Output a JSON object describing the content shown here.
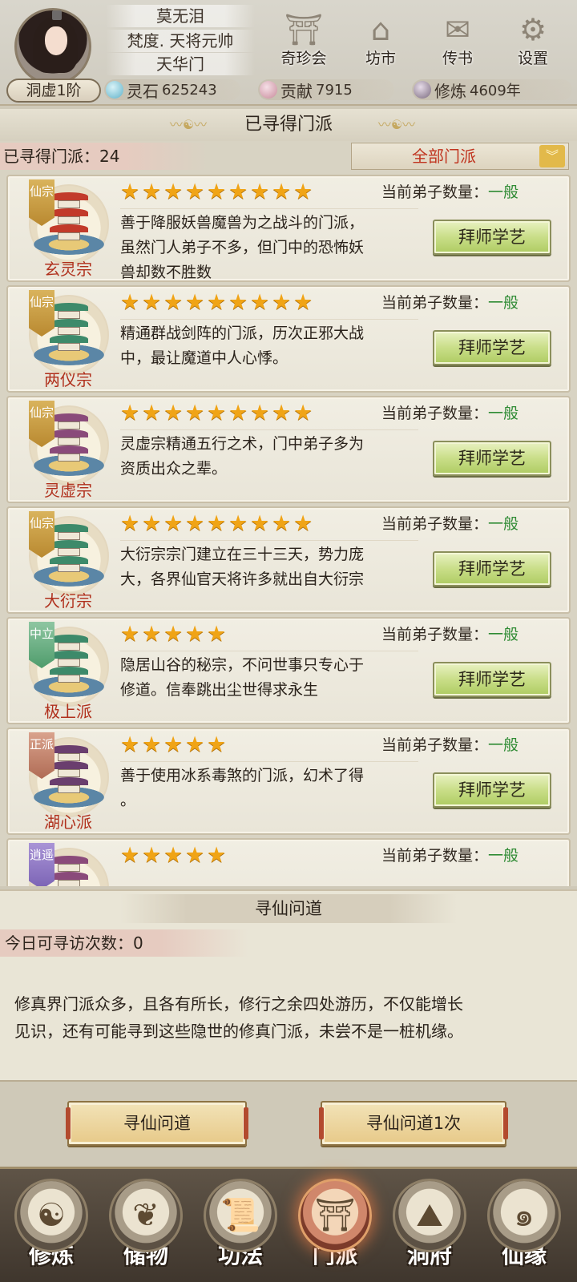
{
  "header": {
    "player_name": "莫无泪",
    "title": "梵度. 天将元帅",
    "sect": "天华门",
    "realm": "洞虚1阶",
    "top_buttons": [
      {
        "label": "奇珍会",
        "icon": "treasure-pavilion-icon"
      },
      {
        "label": "坊市",
        "icon": "market-icon"
      },
      {
        "label": "传书",
        "icon": "scroll-letter-icon"
      },
      {
        "label": "设置",
        "icon": "gear-icon"
      }
    ],
    "resources": [
      {
        "label": "灵石",
        "value": "625243",
        "icon": "spirit-stone-icon",
        "color": "#5fb2c9"
      },
      {
        "label": "贡献",
        "value": "7915",
        "icon": "contribution-icon",
        "color": "#c88a9b"
      },
      {
        "label": "修炼",
        "value": "4609年",
        "icon": "cultivation-icon",
        "color": "#7a6a7e"
      }
    ]
  },
  "sect_panel": {
    "title": "已寻得门派",
    "found_label": "已寻得门派：",
    "found_count": "24",
    "filter_value": "全部门派",
    "sects": [
      {
        "name": "玄灵宗",
        "tag": "仙宗",
        "tag_type": "xian",
        "stars": 9,
        "disciple_label": "当前弟子数量：",
        "disciple_value": "一般",
        "desc_lines": [
          "善于降服妖兽魔兽为之战斗的门派，",
          "虽然门人弟子不多，但门中的恐怖妖",
          "兽却数不胜数"
        ],
        "button": "拜师学艺",
        "roof_color": "#c23a2a"
      },
      {
        "name": "两仪宗",
        "tag": "仙宗",
        "tag_type": "xian",
        "stars": 9,
        "disciple_label": "当前弟子数量：",
        "disciple_value": "一般",
        "desc_lines": [
          "精通群战剑阵的门派，历次正邪大战",
          "中，最让魔道中人心悸。"
        ],
        "button": "拜师学艺",
        "roof_color": "#3d8a6a"
      },
      {
        "name": "灵虚宗",
        "tag": "仙宗",
        "tag_type": "xian",
        "stars": 9,
        "disciple_label": "当前弟子数量：",
        "disciple_value": "一般",
        "desc_lines": [
          "灵虚宗精通五行之术，门中弟子多为",
          "资质出众之辈。"
        ],
        "button": "拜师学艺",
        "roof_color": "#8a4a7a"
      },
      {
        "name": "大衍宗",
        "tag": "仙宗",
        "tag_type": "xian",
        "stars": 9,
        "disciple_label": "当前弟子数量：",
        "disciple_value": "一般",
        "desc_lines": [
          "大衍宗宗门建立在三十三天，势力庞",
          "大，各界仙官天将许多就出自大衍宗"
        ],
        "button": "拜师学艺",
        "roof_color": "#3d8a6a"
      },
      {
        "name": "极上派",
        "tag": "中立",
        "tag_type": "zhong",
        "stars": 5,
        "disciple_label": "当前弟子数量：",
        "disciple_value": "一般",
        "desc_lines": [
          "隐居山谷的秘宗，不问世事只专心于",
          "修道。信奉跳出尘世得求永生"
        ],
        "button": "拜师学艺",
        "roof_color": "#3d8a6a"
      },
      {
        "name": "湖心派",
        "tag": "正派",
        "tag_type": "zheng",
        "stars": 5,
        "disciple_label": "当前弟子数量：",
        "disciple_value": "一般",
        "desc_lines": [
          "善于使用冰系毒煞的门派，幻术了得",
          "。"
        ],
        "button": "拜师学艺",
        "roof_color": "#6a3e6e"
      },
      {
        "name": "",
        "tag": "逍遥",
        "tag_type": "xiao",
        "stars": 5,
        "disciple_label": "当前弟子数量：",
        "disciple_value": "一般",
        "desc_lines": [],
        "button": "",
        "roof_color": "#8a4a7a"
      }
    ]
  },
  "search_panel": {
    "title": "寻仙问道",
    "visits_label": "今日可寻访次数：",
    "visits_value": "0",
    "desc_lines": [
      "修真界门派众多，且各有所长，修行之余四处游历，不仅能增长",
      "见识，还有可能寻到这些隐世的修真门派，未尝不是一桩机缘。"
    ],
    "button_search": "寻仙问道",
    "button_search_once": "寻仙问道1次"
  },
  "bottom_nav": [
    {
      "label": "修炼",
      "icon": "cultivation-nav-icon",
      "active": false
    },
    {
      "label": "储物",
      "icon": "storage-bag-icon",
      "active": false
    },
    {
      "label": "功法",
      "icon": "technique-scroll-icon",
      "active": false
    },
    {
      "label": "门派",
      "icon": "sect-gate-icon",
      "active": true
    },
    {
      "label": "洞府",
      "icon": "cave-dwelling-icon",
      "active": false
    },
    {
      "label": "仙缘",
      "icon": "immortal-fate-icon",
      "active": false
    }
  ]
}
